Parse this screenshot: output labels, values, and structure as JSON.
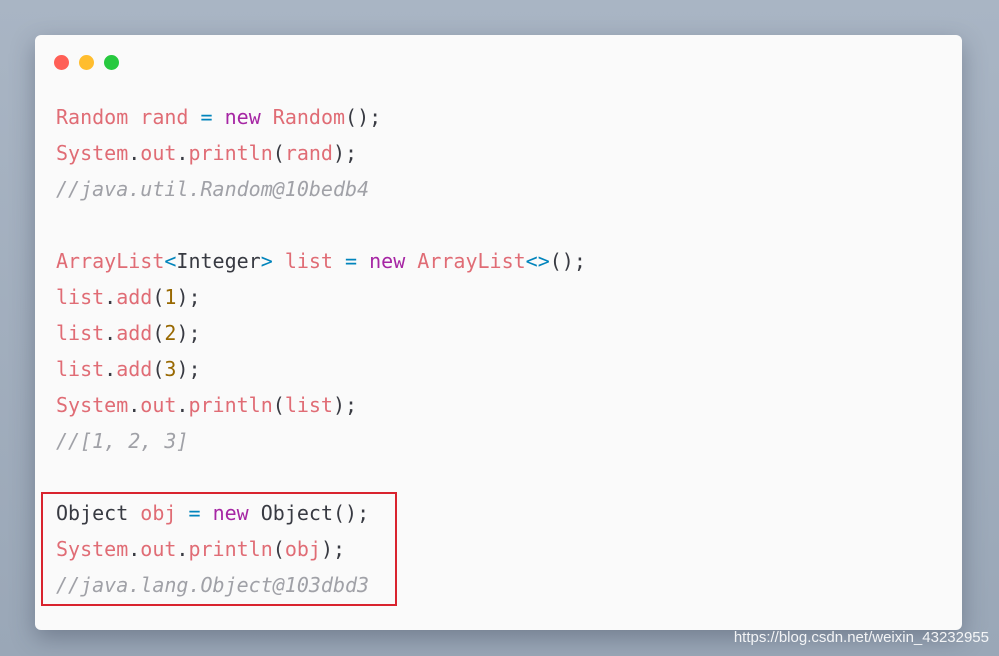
{
  "window": {
    "traffic_lights": [
      {
        "name": "close",
        "color": "#ff5f56"
      },
      {
        "name": "minimize",
        "color": "#ffbd2e"
      },
      {
        "name": "zoom",
        "color": "#27c93f"
      }
    ]
  },
  "code_lines": [
    [
      [
        "ty",
        "Random"
      ],
      [
        "pl",
        " "
      ],
      [
        "pr",
        "rand"
      ],
      [
        "pl",
        " "
      ],
      [
        "op",
        "="
      ],
      [
        "pl",
        " "
      ],
      [
        "kw",
        "new"
      ],
      [
        "pl",
        " "
      ],
      [
        "ty",
        "Random"
      ],
      [
        "pl",
        "();"
      ]
    ],
    [
      [
        "ty",
        "System"
      ],
      [
        "pl",
        "."
      ],
      [
        "pr",
        "out"
      ],
      [
        "pl",
        "."
      ],
      [
        "pr",
        "println"
      ],
      [
        "pl",
        "("
      ],
      [
        "pr",
        "rand"
      ],
      [
        "pl",
        ");"
      ]
    ],
    [
      [
        "cm",
        "//java.util.Random@10bedb4"
      ]
    ],
    [],
    [
      [
        "ty",
        "ArrayList"
      ],
      [
        "op",
        "<"
      ],
      [
        "pl",
        "Integer"
      ],
      [
        "op",
        ">"
      ],
      [
        "pl",
        " "
      ],
      [
        "pr",
        "list"
      ],
      [
        "pl",
        " "
      ],
      [
        "op",
        "="
      ],
      [
        "pl",
        " "
      ],
      [
        "kw",
        "new"
      ],
      [
        "pl",
        " "
      ],
      [
        "ty",
        "ArrayList"
      ],
      [
        "op",
        "<>"
      ],
      [
        "pl",
        "();"
      ]
    ],
    [
      [
        "pr",
        "list"
      ],
      [
        "pl",
        "."
      ],
      [
        "pr",
        "add"
      ],
      [
        "pl",
        "("
      ],
      [
        "num",
        "1"
      ],
      [
        "pl",
        ");"
      ]
    ],
    [
      [
        "pr",
        "list"
      ],
      [
        "pl",
        "."
      ],
      [
        "pr",
        "add"
      ],
      [
        "pl",
        "("
      ],
      [
        "num",
        "2"
      ],
      [
        "pl",
        ");"
      ]
    ],
    [
      [
        "pr",
        "list"
      ],
      [
        "pl",
        "."
      ],
      [
        "pr",
        "add"
      ],
      [
        "pl",
        "("
      ],
      [
        "num",
        "3"
      ],
      [
        "pl",
        ");"
      ]
    ],
    [
      [
        "ty",
        "System"
      ],
      [
        "pl",
        "."
      ],
      [
        "pr",
        "out"
      ],
      [
        "pl",
        "."
      ],
      [
        "pr",
        "println"
      ],
      [
        "pl",
        "("
      ],
      [
        "pr",
        "list"
      ],
      [
        "pl",
        ");"
      ]
    ],
    [
      [
        "cm",
        "//[1, 2, 3]"
      ]
    ],
    [],
    [
      [
        "pl",
        "Object"
      ],
      [
        "pl",
        " "
      ],
      [
        "pr",
        "obj"
      ],
      [
        "pl",
        " "
      ],
      [
        "op",
        "="
      ],
      [
        "pl",
        " "
      ],
      [
        "kw",
        "new"
      ],
      [
        "pl",
        " "
      ],
      [
        "pl",
        "Object"
      ],
      [
        "pl",
        "();"
      ]
    ],
    [
      [
        "ty",
        "System"
      ],
      [
        "pl",
        "."
      ],
      [
        "pr",
        "out"
      ],
      [
        "pl",
        "."
      ],
      [
        "pr",
        "println"
      ],
      [
        "pl",
        "("
      ],
      [
        "pr",
        "obj"
      ],
      [
        "pl",
        ");"
      ]
    ],
    [
      [
        "cm",
        "//java.lang.Object@103dbd3"
      ]
    ]
  ],
  "highlight_color": "#d9232e",
  "watermark": "https://blog.csdn.net/weixin_43232955"
}
